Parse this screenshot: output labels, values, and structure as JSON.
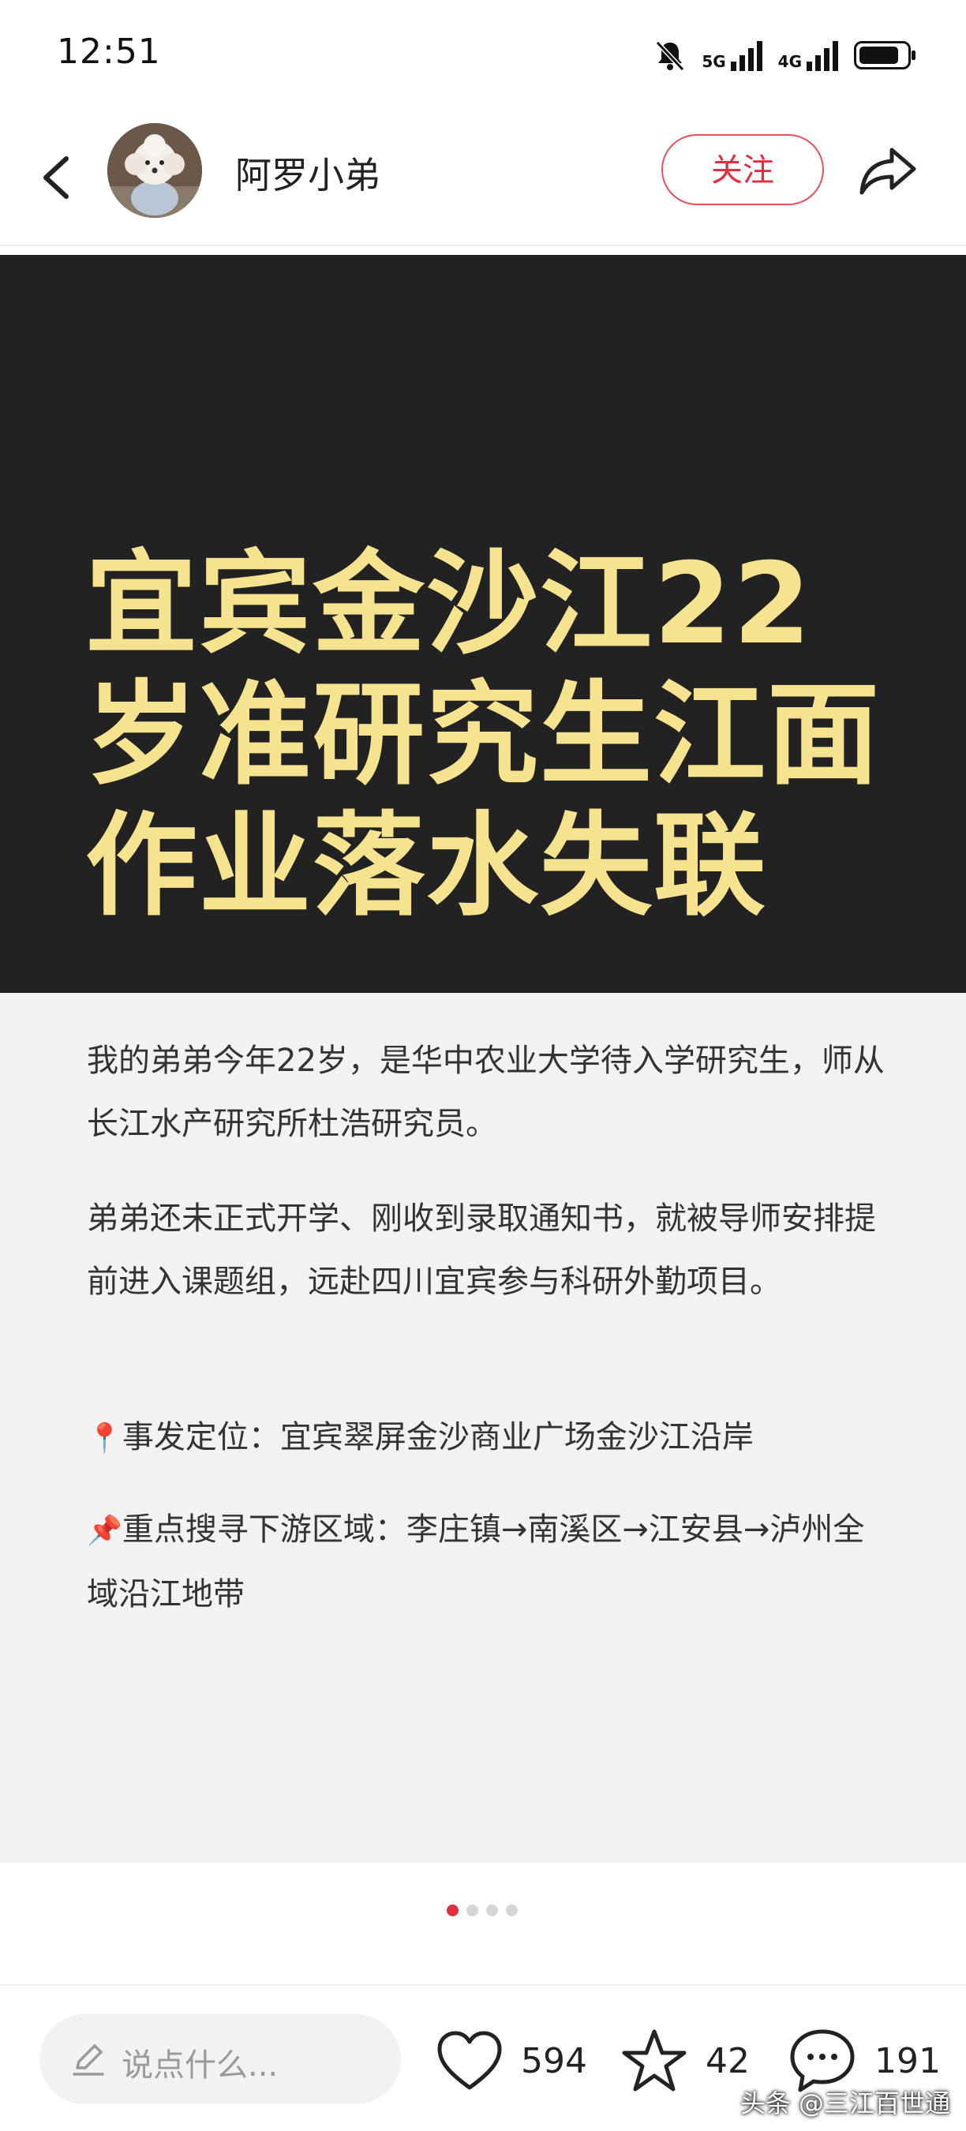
{
  "status_bar": {
    "time": "12:51",
    "network_1": "5G",
    "network_2": "4G",
    "battery_level": 0.85
  },
  "header": {
    "author_name": "阿罗小弟",
    "follow_label": "关注"
  },
  "hero": {
    "title_line_1": "宜宾金沙江22",
    "title_line_2": "岁准研究生江面",
    "title_line_3": "作业落水失联",
    "title_color": "#f6e38f"
  },
  "content": {
    "para_1": "我的弟弟今年22岁，是华中农业大学待入学研究生，师从长江水产研究所杜浩研究员。",
    "para_2": "弟弟还未正式开学、刚收到录取通知书，就被导师安排提前进入课题组，远赴四川宜宾参与科研外勤项目。",
    "para_3_icon": "📍",
    "para_3": "事发定位：宜宾翠屏金沙商业广场金沙江沿岸",
    "para_4_icon": "📌",
    "para_4": "重点搜寻下游区域：李庄镇→南溪区→江安县→泸州全域沿江地带"
  },
  "pager": {
    "page_count": 4,
    "current_page": 1
  },
  "bottom_bar": {
    "comment_placeholder": "说点什么...",
    "like_count": "594",
    "favorite_count": "42",
    "comment_count": "191",
    "watermark": "头条 @三江百世通"
  },
  "colors": {
    "accent": "#e0303e",
    "hero_background": "#222222",
    "content_background": "#f2f2f2"
  }
}
